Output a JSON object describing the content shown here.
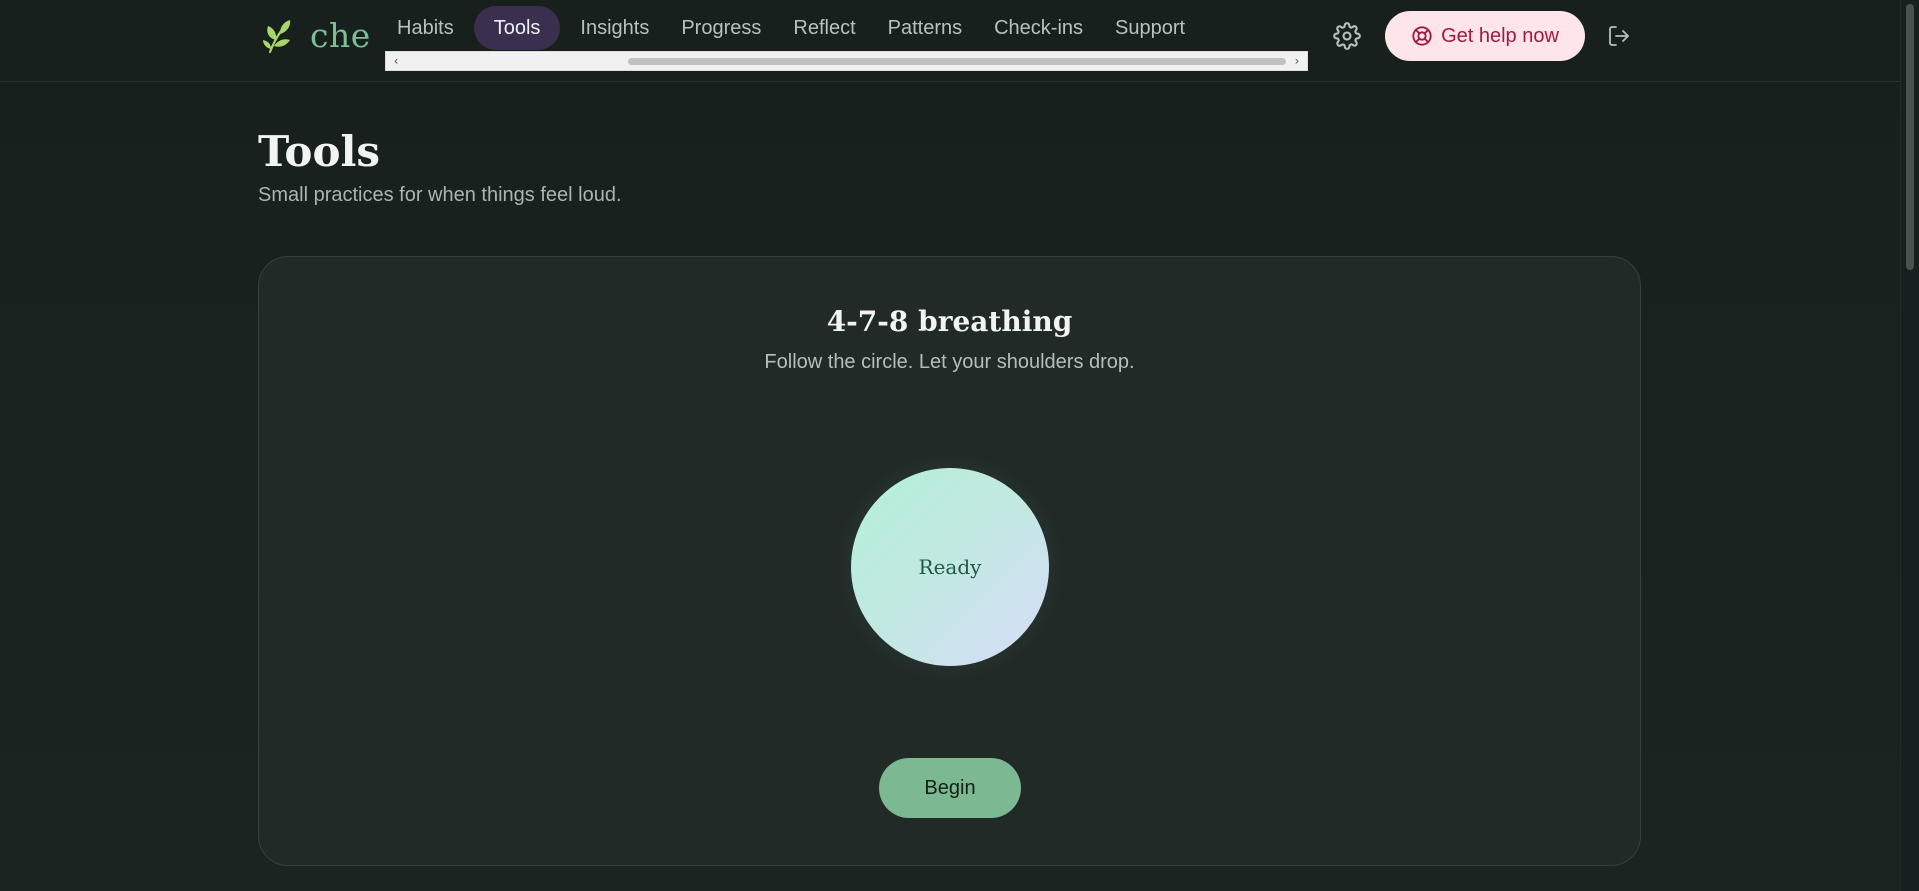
{
  "brand": {
    "name": "che",
    "icon": "leaf-icon",
    "color": "#7cbf93"
  },
  "nav": {
    "items": [
      {
        "label": "Habits",
        "active": false
      },
      {
        "label": "Tools",
        "active": true
      },
      {
        "label": "Insights",
        "active": false
      },
      {
        "label": "Progress",
        "active": false
      },
      {
        "label": "Reflect",
        "active": false
      },
      {
        "label": "Patterns",
        "active": false
      },
      {
        "label": "Check-ins",
        "active": false
      },
      {
        "label": "Support",
        "active": false
      }
    ],
    "scroll_left": "‹",
    "scroll_right": "›"
  },
  "header": {
    "settings_icon": "gear-icon",
    "help_button_label": "Get help now",
    "help_icon": "lifebuoy-icon",
    "logout_icon": "logout-icon"
  },
  "page": {
    "title": "Tools",
    "subtitle": "Small practices for when things feel loud."
  },
  "breathing_card": {
    "title": "4-7-8 breathing",
    "subtitle": "Follow the circle. Let your shoulders drop.",
    "phase_label": "Ready",
    "begin_label": "Begin"
  },
  "colors": {
    "background": "#18201e",
    "card": "#212a27",
    "active_tab": "#3a2f4e",
    "help_bg": "#fde5ea",
    "help_text": "#a4173f",
    "begin_bg": "#7cb891"
  }
}
